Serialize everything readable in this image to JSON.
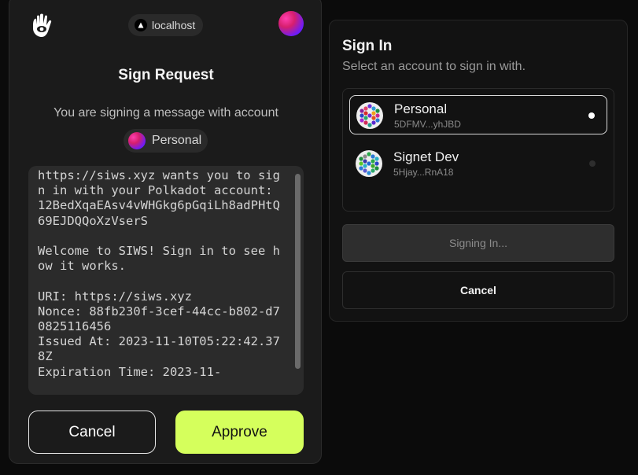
{
  "popup": {
    "host": "localhost",
    "title": "Sign Request",
    "subtitle": "You are signing a message with account",
    "account_name": "Personal",
    "message": "https://siws.xyz wants you to sign in with your Polkadot account:\n12BedXqaEAsv4vWHGkg6pGqiLh8adPHtQ69EJDQQoXzVserS\n\nWelcome to SIWS! Sign in to see how it works.\n\nURI: https://siws.xyz\nNonce: 88fb230f-3cef-44cc-b802-d70825116456\nIssued At: 2023-11-10T05:22:42.378Z\nExpiration Time: 2023-11-",
    "cancel_label": "Cancel",
    "approve_label": "Approve",
    "accent_color": "#d5ff5c"
  },
  "signin": {
    "title": "Sign In",
    "subtitle": "Select an account to sign in with.",
    "accounts": [
      {
        "name": "Personal",
        "address": "5DFMV...yhJBD",
        "selected": true
      },
      {
        "name": "Signet Dev",
        "address": "5Hjay...RnA18",
        "selected": false
      }
    ],
    "signing_label": "Signing In...",
    "cancel_label": "Cancel"
  }
}
